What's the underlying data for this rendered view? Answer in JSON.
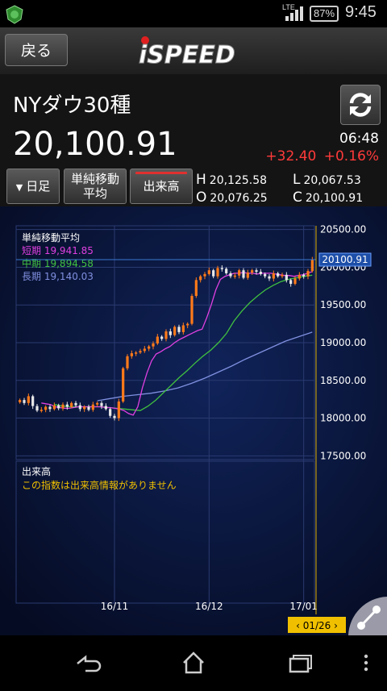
{
  "status_bar": {
    "network": "LTE",
    "battery": "87%",
    "time": "9:45"
  },
  "app_bar": {
    "back_label": "戻る",
    "logo_text": "iSPEED"
  },
  "quote": {
    "title": "NYダウ30種",
    "price": "20,100.91",
    "time": "06:48",
    "change": "+32.40",
    "change_pct": "+0.16%",
    "high_label": "H",
    "high": "20,125.58",
    "low_label": "L",
    "low": "20,067.53",
    "open_label": "O",
    "open": "20,076.25",
    "close_label": "C",
    "close": "20,100.91"
  },
  "toolbar": {
    "period_label": "日足",
    "sma_label_line1": "単純移動",
    "sma_label_line2": "平均",
    "volume_label": "出来高"
  },
  "colors": {
    "up": "#ff7a1a",
    "down": "#e8e8e8",
    "short_ma": "#e040e0",
    "mid_ma": "#40c040",
    "long_ma": "#8090e0",
    "current_price": "#3a7ad0",
    "accent_yellow": "#f0c000",
    "change_red": "#ff3a3a"
  },
  "chart_data": {
    "type": "candlestick",
    "title": "単純移動平均",
    "ylim": [
      17450,
      20550
    ],
    "yticks": [
      17500,
      18000,
      18500,
      19000,
      19500,
      20000,
      20500
    ],
    "ytick_labels": [
      "17500.00",
      "18000.00",
      "18500.00",
      "19000.00",
      "19500.00",
      "20000.00",
      "20500.00"
    ],
    "current_price_label": "20100.91",
    "xtick_labels": [
      "16/11",
      "16/12",
      "17/01"
    ],
    "cursor_label": "01/26",
    "legend": [
      {
        "name": "短期",
        "value": "19,941.85",
        "color": "#e040e0"
      },
      {
        "name": "中期",
        "value": "19,894.58",
        "color": "#40c040"
      },
      {
        "name": "長期",
        "value": "19,140.03",
        "color": "#8090e0"
      }
    ],
    "closes": [
      18240,
      18200,
      18290,
      18160,
      18100,
      18110,
      18150,
      18120,
      18170,
      18130,
      18180,
      18150,
      18200,
      18170,
      18120,
      18150,
      18110,
      18180,
      18200,
      18160,
      18120,
      18030,
      18000,
      18220,
      18660,
      18820,
      18860,
      18870,
      18890,
      18920,
      18950,
      18990,
      19080,
      19050,
      19150,
      19100,
      19210,
      19140,
      19230,
      19250,
      19620,
      19830,
      19880,
      19910,
      19960,
      19880,
      19990,
      19980,
      19920,
      19880,
      19890,
      19960,
      19860,
      19930,
      19960,
      19940,
      19910,
      19880,
      19850,
      19920,
      19880,
      19900,
      19830,
      19780,
      19850,
      19900,
      19880,
      19950,
      20100.91
    ],
    "short_ma": [
      18200,
      18190,
      18180,
      18150,
      18140,
      18130,
      18130,
      18140,
      18150,
      18150,
      18150,
      18150,
      18150,
      18150,
      18140,
      18140,
      18130,
      18120,
      18100,
      18060,
      18040,
      18150,
      18400,
      18600,
      18760,
      18850,
      18880,
      18920,
      18950,
      19000,
      19040,
      19070,
      19100,
      19130,
      19160,
      19180,
      19330,
      19500,
      19700,
      19840,
      19880,
      19900,
      19920,
      19920,
      19930,
      19920,
      19920,
      19910,
      19920,
      19920,
      19920,
      19910,
      19900,
      19890,
      19890,
      19880,
      19890,
      19900,
      19920,
      19941.85
    ],
    "mid_ma": [
      18180,
      18160,
      18150,
      18150,
      18150,
      18150,
      18150,
      18140,
      18130,
      18120,
      18110,
      18100,
      18160,
      18240,
      18340,
      18440,
      18540,
      18630,
      18730,
      18820,
      18900,
      19000,
      19120,
      19290,
      19420,
      19530,
      19620,
      19700,
      19760,
      19810,
      19840,
      19860,
      19880,
      19894.58
    ],
    "long_ma": [
      18230,
      18260,
      18290,
      18310,
      18330,
      18360,
      18400,
      18460,
      18530,
      18610,
      18690,
      18780,
      18860,
      18940,
      19020,
      19080,
      19140.03
    ],
    "volume_title": "出来高",
    "volume_message": "この指数は出来高情報がありません"
  }
}
